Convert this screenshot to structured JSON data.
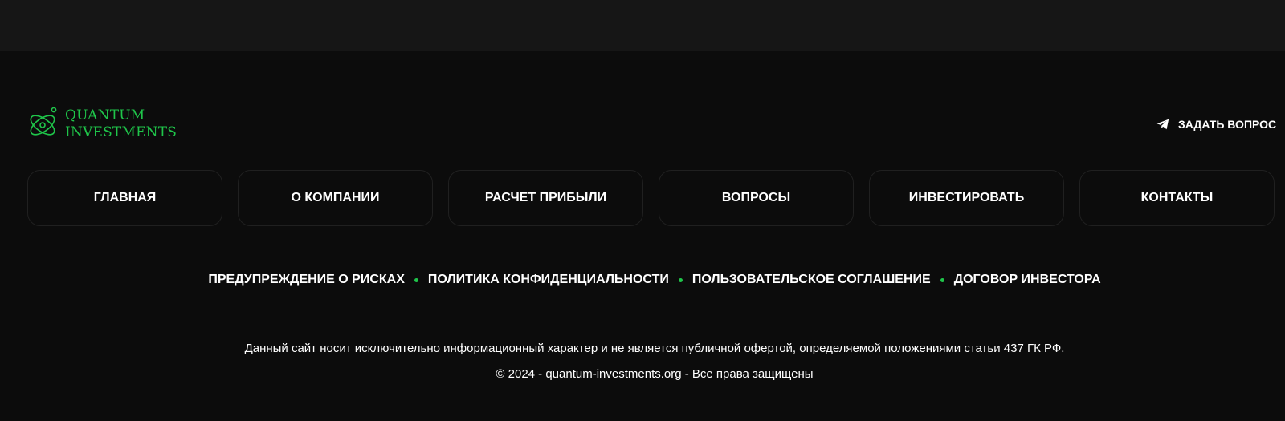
{
  "logo": {
    "line1": "QUANTUM",
    "line2": "INVESTMENTS",
    "color": "#1fc54a"
  },
  "header": {
    "ask_label": "ЗАДАТЬ ВОПРОС",
    "ask_icon": "telegram-icon"
  },
  "nav": {
    "items": [
      {
        "label": "ГЛАВНАЯ"
      },
      {
        "label": "О КОМПАНИИ"
      },
      {
        "label": "РАСЧЕТ ПРИБЫЛИ"
      },
      {
        "label": "ВОПРОСЫ"
      },
      {
        "label": "ИНВЕСТИРОВАТЬ"
      },
      {
        "label": "КОНТАКТЫ"
      }
    ]
  },
  "legal_links": [
    {
      "label": "ПРЕДУПРЕЖДЕНИЕ О РИСКАХ"
    },
    {
      "label": "ПОЛИТИКА КОНФИДЕНЦИАЛЬНОСТИ"
    },
    {
      "label": "ПОЛЬЗОВАТЕЛЬСКОЕ СОГЛАШЕНИЕ"
    },
    {
      "label": "ДОГОВОР ИНВЕСТОРА"
    }
  ],
  "footer": {
    "disclaimer": "Данный сайт носит исключительно информационный характер и не является публичной офертой, определяемой положениями статьи 437 ГК РФ.",
    "copyright": "© 2024 - quantum-investments.org - Все права защищены"
  },
  "colors": {
    "accent": "#1fc54a",
    "background": "#0c0c0c",
    "top_band": "#161616",
    "nav_border": "#202020"
  }
}
